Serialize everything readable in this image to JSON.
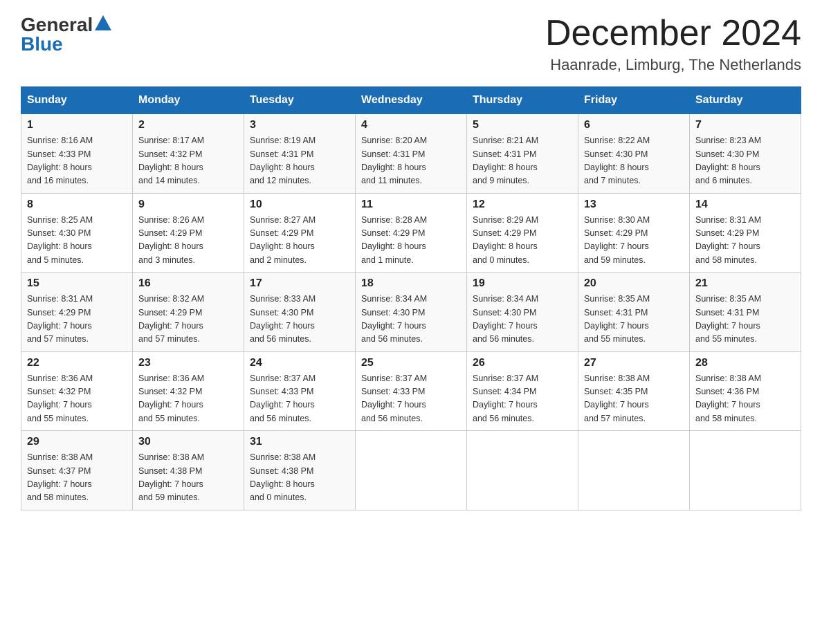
{
  "header": {
    "logo_general": "General",
    "logo_blue": "Blue",
    "month_year": "December 2024",
    "location": "Haanrade, Limburg, The Netherlands"
  },
  "days_of_week": [
    "Sunday",
    "Monday",
    "Tuesday",
    "Wednesday",
    "Thursday",
    "Friday",
    "Saturday"
  ],
  "weeks": [
    [
      {
        "day": "1",
        "sunrise": "8:16 AM",
        "sunset": "4:33 PM",
        "daylight": "8 hours and 16 minutes."
      },
      {
        "day": "2",
        "sunrise": "8:17 AM",
        "sunset": "4:32 PM",
        "daylight": "8 hours and 14 minutes."
      },
      {
        "day": "3",
        "sunrise": "8:19 AM",
        "sunset": "4:31 PM",
        "daylight": "8 hours and 12 minutes."
      },
      {
        "day": "4",
        "sunrise": "8:20 AM",
        "sunset": "4:31 PM",
        "daylight": "8 hours and 11 minutes."
      },
      {
        "day": "5",
        "sunrise": "8:21 AM",
        "sunset": "4:31 PM",
        "daylight": "8 hours and 9 minutes."
      },
      {
        "day": "6",
        "sunrise": "8:22 AM",
        "sunset": "4:30 PM",
        "daylight": "8 hours and 7 minutes."
      },
      {
        "day": "7",
        "sunrise": "8:23 AM",
        "sunset": "4:30 PM",
        "daylight": "8 hours and 6 minutes."
      }
    ],
    [
      {
        "day": "8",
        "sunrise": "8:25 AM",
        "sunset": "4:30 PM",
        "daylight": "8 hours and 5 minutes."
      },
      {
        "day": "9",
        "sunrise": "8:26 AM",
        "sunset": "4:29 PM",
        "daylight": "8 hours and 3 minutes."
      },
      {
        "day": "10",
        "sunrise": "8:27 AM",
        "sunset": "4:29 PM",
        "daylight": "8 hours and 2 minutes."
      },
      {
        "day": "11",
        "sunrise": "8:28 AM",
        "sunset": "4:29 PM",
        "daylight": "8 hours and 1 minute."
      },
      {
        "day": "12",
        "sunrise": "8:29 AM",
        "sunset": "4:29 PM",
        "daylight": "8 hours and 0 minutes."
      },
      {
        "day": "13",
        "sunrise": "8:30 AM",
        "sunset": "4:29 PM",
        "daylight": "7 hours and 59 minutes."
      },
      {
        "day": "14",
        "sunrise": "8:31 AM",
        "sunset": "4:29 PM",
        "daylight": "7 hours and 58 minutes."
      }
    ],
    [
      {
        "day": "15",
        "sunrise": "8:31 AM",
        "sunset": "4:29 PM",
        "daylight": "7 hours and 57 minutes."
      },
      {
        "day": "16",
        "sunrise": "8:32 AM",
        "sunset": "4:29 PM",
        "daylight": "7 hours and 57 minutes."
      },
      {
        "day": "17",
        "sunrise": "8:33 AM",
        "sunset": "4:30 PM",
        "daylight": "7 hours and 56 minutes."
      },
      {
        "day": "18",
        "sunrise": "8:34 AM",
        "sunset": "4:30 PM",
        "daylight": "7 hours and 56 minutes."
      },
      {
        "day": "19",
        "sunrise": "8:34 AM",
        "sunset": "4:30 PM",
        "daylight": "7 hours and 56 minutes."
      },
      {
        "day": "20",
        "sunrise": "8:35 AM",
        "sunset": "4:31 PM",
        "daylight": "7 hours and 55 minutes."
      },
      {
        "day": "21",
        "sunrise": "8:35 AM",
        "sunset": "4:31 PM",
        "daylight": "7 hours and 55 minutes."
      }
    ],
    [
      {
        "day": "22",
        "sunrise": "8:36 AM",
        "sunset": "4:32 PM",
        "daylight": "7 hours and 55 minutes."
      },
      {
        "day": "23",
        "sunrise": "8:36 AM",
        "sunset": "4:32 PM",
        "daylight": "7 hours and 55 minutes."
      },
      {
        "day": "24",
        "sunrise": "8:37 AM",
        "sunset": "4:33 PM",
        "daylight": "7 hours and 56 minutes."
      },
      {
        "day": "25",
        "sunrise": "8:37 AM",
        "sunset": "4:33 PM",
        "daylight": "7 hours and 56 minutes."
      },
      {
        "day": "26",
        "sunrise": "8:37 AM",
        "sunset": "4:34 PM",
        "daylight": "7 hours and 56 minutes."
      },
      {
        "day": "27",
        "sunrise": "8:38 AM",
        "sunset": "4:35 PM",
        "daylight": "7 hours and 57 minutes."
      },
      {
        "day": "28",
        "sunrise": "8:38 AM",
        "sunset": "4:36 PM",
        "daylight": "7 hours and 58 minutes."
      }
    ],
    [
      {
        "day": "29",
        "sunrise": "8:38 AM",
        "sunset": "4:37 PM",
        "daylight": "7 hours and 58 minutes."
      },
      {
        "day": "30",
        "sunrise": "8:38 AM",
        "sunset": "4:38 PM",
        "daylight": "7 hours and 59 minutes."
      },
      {
        "day": "31",
        "sunrise": "8:38 AM",
        "sunset": "4:38 PM",
        "daylight": "8 hours and 0 minutes."
      },
      null,
      null,
      null,
      null
    ]
  ],
  "labels": {
    "sunrise": "Sunrise:",
    "sunset": "Sunset:",
    "daylight": "Daylight:"
  }
}
